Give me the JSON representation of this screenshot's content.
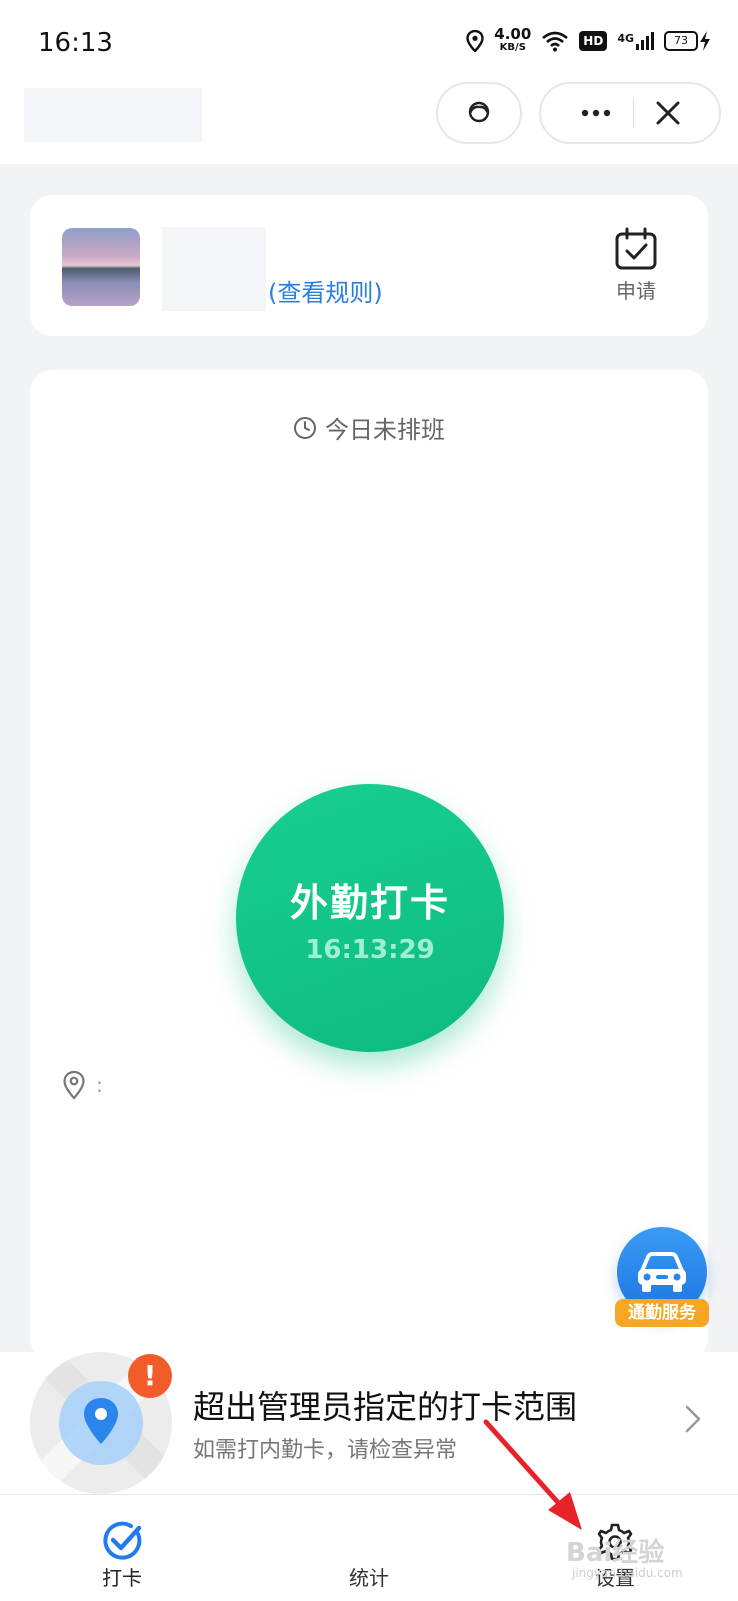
{
  "status_bar": {
    "time": "16:13",
    "net_speed_value": "4.00",
    "net_speed_unit": "KB/S",
    "hd_label": "HD",
    "network_label": "4G",
    "battery_level": "73"
  },
  "header": {
    "service_icon": "headset-icon",
    "more_icon": "more-dots-icon",
    "close_icon": "close-icon"
  },
  "profile_card": {
    "rules_link": "(查看规则)",
    "apply_label": "申请",
    "apply_icon": "calendar-check-icon"
  },
  "punch_card": {
    "schedule_text": "今日未排班",
    "punch_button_label": "外勤打卡",
    "punch_time": "16:13:29",
    "location_text": ":"
  },
  "commute": {
    "label": "通勤服务",
    "icon": "car-icon"
  },
  "alert": {
    "title": "超出管理员指定的打卡范围",
    "subtitle": "如需打内勤卡，请检查异常",
    "badge": "!"
  },
  "tabs": [
    {
      "label": "打卡",
      "icon": "check-icon",
      "active": true
    },
    {
      "label": "统计",
      "icon": "",
      "active": false
    },
    {
      "label": "设置",
      "icon": "gear-icon",
      "active": false
    }
  ],
  "watermark": {
    "text": "Bai经验",
    "url": "jingyan.baidu.com"
  },
  "colors": {
    "accent_green": "#12c48a",
    "link_blue": "#2a7de1",
    "tab_blue": "#1e7cf0",
    "alert_orange": "#f25c2b",
    "commute_yellow": "#f5a623",
    "annotation_red": "#e8222a"
  }
}
